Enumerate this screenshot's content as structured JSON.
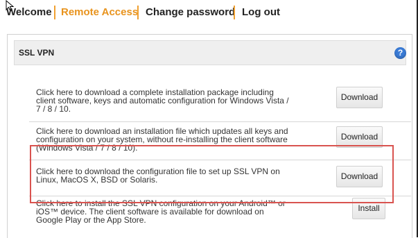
{
  "nav": {
    "items": [
      "Welcome",
      "Remote Access",
      "Change password",
      "Log out"
    ]
  },
  "panel": {
    "title": "SSL VPN",
    "help_icon": "?"
  },
  "rows": [
    {
      "lines": [
        "Click here to download a complete installation package including",
        "client software, keys and automatic configuration for Windows Vista /",
        "7 / 8 / 10."
      ],
      "button": "Download"
    },
    {
      "lines": [
        "Click here to download an installation file which updates all keys and",
        "configuration on your system, without re-installing the client software",
        "(Windows Vista / 7 / 8 / 10)."
      ],
      "button": "Download"
    },
    {
      "lines": [
        "Click here to download the configuration file to set up SSL VPN on",
        "Linux, MacOS X, BSD or Solaris."
      ],
      "button": "Download"
    },
    {
      "lines": [
        "Click here to install the SSL VPN configuration on your Android™ or",
        "iOS™ device. The client software is available for download on",
        "Google Play or the App Store."
      ],
      "button": "Install"
    }
  ],
  "colors": {
    "accent": "#e8931d",
    "highlight": "#d9534f",
    "help": "#3a7bd5"
  }
}
